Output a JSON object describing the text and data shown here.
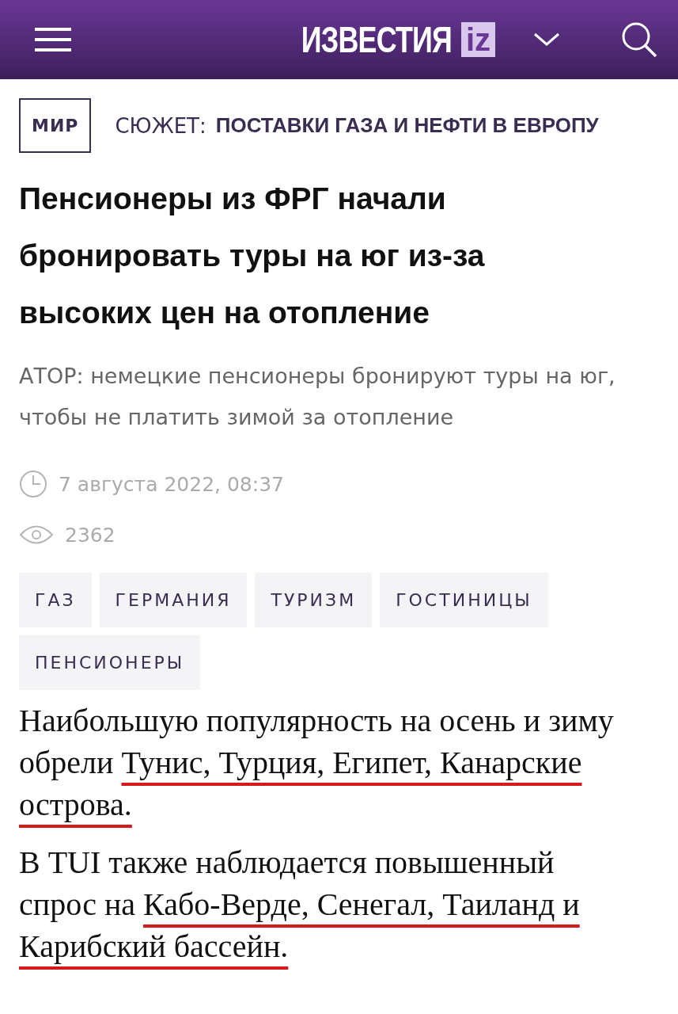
{
  "header": {
    "logo_text": "ИЗВЕСТИЯ",
    "logo_badge": "iz"
  },
  "rubric": {
    "section": "МИР",
    "story_label": "СЮЖЕТ:",
    "story_title": "ПОСТАВКИ ГАЗА И НЕФТИ В ЕВРОПУ"
  },
  "article": {
    "title": "Пенсионеры из ФРГ начали бронировать туры на юг из-за высоких цен на отопление",
    "lead": "АТОР: немецкие пенсионеры бронируют туры на юг, чтобы не платить зимой за отопление",
    "date": "7 августа 2022, 08:37",
    "views": "2362",
    "tags": [
      "ГАЗ",
      "ГЕРМАНИЯ",
      "ТУРИЗМ",
      "ГОСТИНИЦЫ",
      "ПЕНСИОНЕРЫ"
    ],
    "paragraphs": [
      {
        "segments": [
          {
            "text": "Наибольшую популярность на осень и зиму обрели ",
            "marked": false
          },
          {
            "text": "Тунис, Турция, Египет, Канарские острова.",
            "marked": true
          }
        ]
      },
      {
        "segments": [
          {
            "text": "В TUI также наблюдается повышенный спрос на ",
            "marked": false
          },
          {
            "text": "Кабо-Верде, Сенегал, Таиланд и Карибский бассейн.",
            "marked": true
          }
        ]
      }
    ]
  }
}
